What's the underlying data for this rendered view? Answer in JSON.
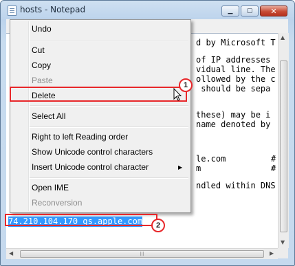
{
  "window": {
    "title": "hosts - Notepad",
    "minimize_glyph": "▁",
    "maximize_glyph": "▢",
    "close_glyph": "✕"
  },
  "editor": {
    "lines": [
      {
        "text": "d by Microsoft T"
      },
      {
        "text": "of IP addresses"
      },
      {
        "text": "vidual line. The"
      },
      {
        "text": "ollowed by the c"
      },
      {
        "text": " should be sepa"
      },
      {
        "text": "these) may be i"
      },
      {
        "text": "name denoted by"
      },
      {
        "text": "le.com"
      },
      {
        "text": "m"
      },
      {
        "text": "ndled within DNS"
      },
      {
        "text": "74.210.104.170 gs.apple.com"
      }
    ],
    "hash_marks": [
      "#",
      "#"
    ]
  },
  "context_menu": {
    "items": [
      {
        "label": "Undo",
        "disabled": false
      },
      {
        "label": "Cut",
        "disabled": false
      },
      {
        "label": "Copy",
        "disabled": false
      },
      {
        "label": "Paste",
        "disabled": true
      },
      {
        "label": "Delete",
        "disabled": false
      },
      {
        "label": "Select All",
        "disabled": false
      },
      {
        "label": "Right to left Reading order",
        "disabled": false
      },
      {
        "label": "Show Unicode control characters",
        "disabled": false
      },
      {
        "label": "Insert Unicode control character",
        "disabled": false,
        "submenu": true
      },
      {
        "label": "Open IME",
        "disabled": false
      },
      {
        "label": "Reconversion",
        "disabled": true
      }
    ],
    "submenu_arrow": "▶"
  },
  "annotations": {
    "badge_1": "1",
    "badge_2": "2",
    "highlight_color": "#e8272a"
  },
  "scrollbars": {
    "up_arrow": "▲",
    "down_arrow": "▼",
    "left_arrow": "◀",
    "right_arrow": "▶",
    "grip": "|||"
  }
}
